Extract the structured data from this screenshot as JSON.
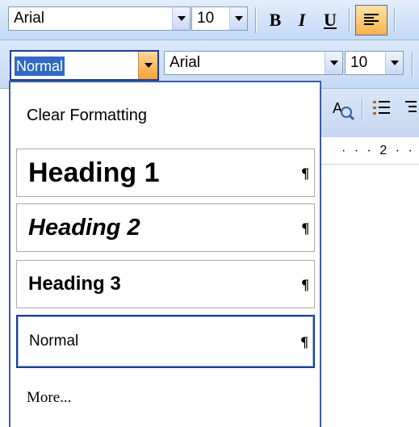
{
  "toolbar_top": {
    "font_name": "Arial",
    "font_size": "10",
    "bold_label": "B",
    "italic_label": "I",
    "underline_label": "U"
  },
  "toolbar_style": {
    "style_value": "Normal",
    "font_name": "Arial",
    "font_size": "10"
  },
  "ruler": {
    "label": "· · · 2 · ·"
  },
  "style_menu": {
    "clear_formatting": "Clear Formatting",
    "items": [
      {
        "label": "Heading 1",
        "mark": "¶"
      },
      {
        "label": "Heading 2",
        "mark": "¶"
      },
      {
        "label": "Heading 3",
        "mark": "¶"
      },
      {
        "label": "Normal",
        "mark": "¶"
      }
    ],
    "more": "More..."
  },
  "colors": {
    "toolbar_bg": "#c4d9f5",
    "selection": "#316ac5",
    "dropdown_border": "#1c3f94",
    "active_arrow": "#f7a13a"
  },
  "icons": [
    "align-left-icon",
    "find-replace-icon",
    "numbering-icon"
  ]
}
